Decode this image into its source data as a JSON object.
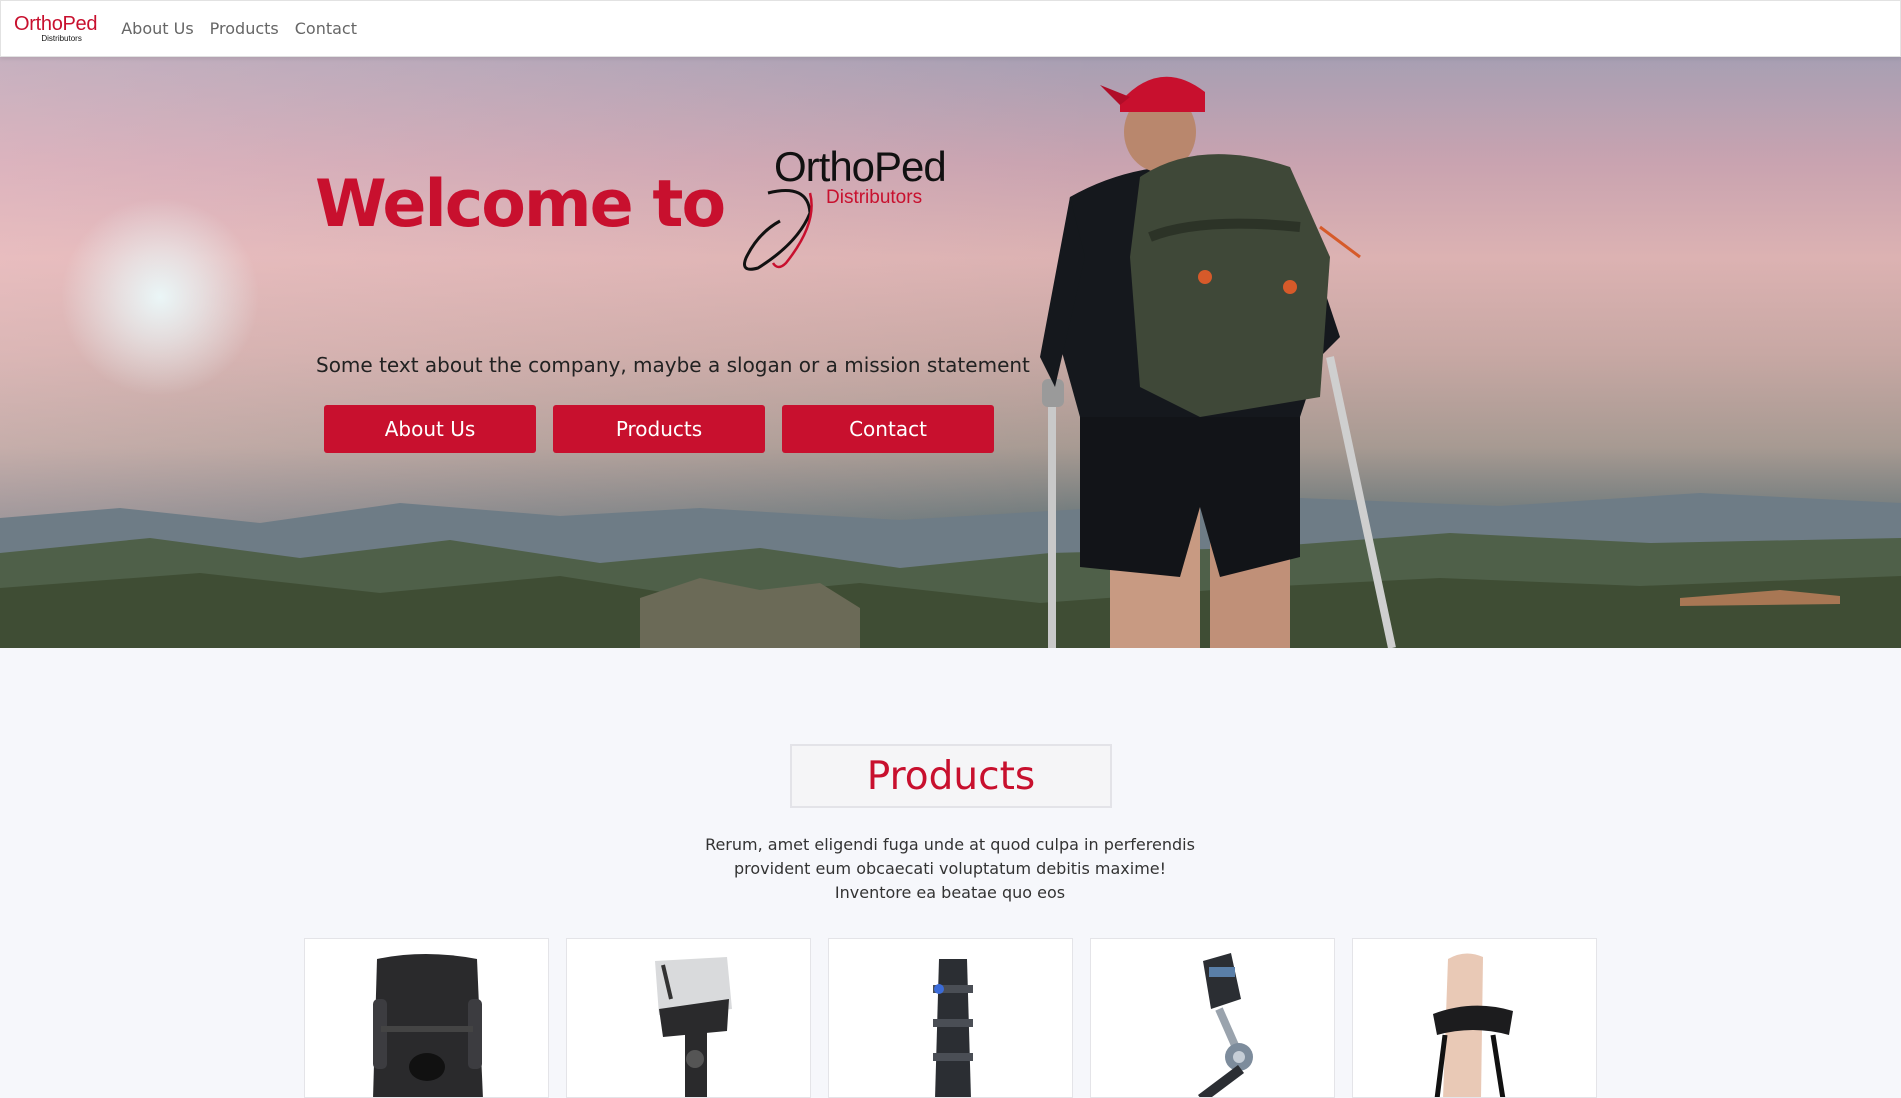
{
  "nav": {
    "brand_main": "OrthoPed",
    "brand_sub": "Distributors",
    "links": [
      "About Us",
      "Products",
      "Contact"
    ]
  },
  "hero": {
    "title": "Welcome to",
    "logo_main": "OrthoPed",
    "logo_sub": "Distributors",
    "text": "Some text about the company, maybe a slogan or a mission statement",
    "buttons": [
      "About Us",
      "Products",
      "Contact"
    ]
  },
  "products": {
    "title": "Products",
    "description_lines": [
      "Rerum, amet eligendi fuga unde at quod culpa in perferendis",
      "provident eum obcaecati voluptatum debitis maxime!",
      "Inventore ea beatae quo eos"
    ],
    "cards": [
      {
        "icon": "knee-brace-icon"
      },
      {
        "icon": "hinged-knee-brace-icon"
      },
      {
        "icon": "walker-boot-icon"
      },
      {
        "icon": "rom-knee-brace-icon"
      },
      {
        "icon": "ankle-foot-orthosis-icon"
      }
    ]
  },
  "colors": {
    "accent": "#c8102e",
    "background": "#f6f7fb"
  }
}
